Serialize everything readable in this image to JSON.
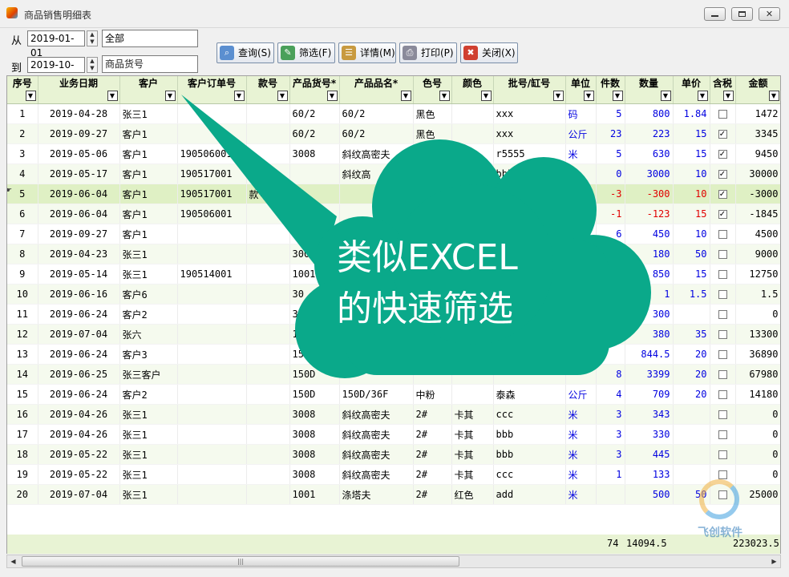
{
  "window": {
    "title": "商品销售明细表"
  },
  "filters": {
    "from_label": "从",
    "to_label": "到",
    "from_date": "2019-01-01",
    "to_date": "2019-10-15",
    "customer_value": "全部",
    "product_placeholder": "商品货号"
  },
  "buttons": {
    "query": "查询(S)",
    "filter": "筛选(F)",
    "detail": "详情(M)",
    "print": "打印(P)",
    "close": "关闭(X)"
  },
  "columns": [
    "序号",
    "业务日期",
    "客户",
    "客户订单号",
    "款号",
    "产品货号*",
    "产品品名*",
    "色号",
    "颜色",
    "批号/缸号",
    "单位",
    "件数",
    "数量",
    "单价",
    "含税",
    "金额"
  ],
  "rows": [
    {
      "no": "1",
      "date": "2019-04-28",
      "cust": "张三1",
      "order": "",
      "style": "",
      "code": "60/2",
      "name": "60/2",
      "cno": "黑色",
      "color": "",
      "batch": "xxx",
      "unit": "码",
      "pcs": "5",
      "qty": "800",
      "price": "1.84",
      "tax": false,
      "amt": "1472"
    },
    {
      "no": "2",
      "date": "2019-09-27",
      "cust": "客户1",
      "order": "",
      "style": "",
      "code": "60/2",
      "name": "60/2",
      "cno": "黑色",
      "color": "",
      "batch": "xxx",
      "unit": "公斤",
      "pcs": "23",
      "qty": "223",
      "price": "15",
      "tax": true,
      "amt": "3345"
    },
    {
      "no": "3",
      "date": "2019-05-06",
      "cust": "客户1",
      "order": "190506001",
      "style": "",
      "code": "3008",
      "name": "斜纹高密夫",
      "cno": "1#",
      "color": "大黑",
      "batch": "r5555",
      "unit": "米",
      "pcs": "5",
      "qty": "630",
      "price": "15",
      "tax": true,
      "amt": "9450"
    },
    {
      "no": "4",
      "date": "2019-05-17",
      "cust": "客户1",
      "order": "190517001",
      "style": "款号",
      "code": "",
      "name": "斜纹高",
      "cno": "",
      "color": "",
      "batch": "bbb",
      "unit": "米",
      "pcs": "0",
      "qty": "3000",
      "price": "10",
      "tax": true,
      "amt": "30000"
    },
    {
      "no": "5",
      "date": "2019-06-04",
      "cust": "客户1",
      "order": "190517001",
      "style": "款号2",
      "code": "",
      "name": "",
      "cno": "",
      "color": "",
      "batch": "bb",
      "unit": "米",
      "pcs": "-3",
      "qty": "-300",
      "price": "10",
      "tax": true,
      "amt": "-3000",
      "neg": true,
      "cur": true
    },
    {
      "no": "6",
      "date": "2019-06-04",
      "cust": "客户1",
      "order": "190506001",
      "style": "",
      "code": "300",
      "name": "",
      "cno": "",
      "color": "",
      "batch": "555",
      "unit": "米",
      "pcs": "-1",
      "qty": "-123",
      "price": "15",
      "tax": true,
      "amt": "-1845",
      "neg": true
    },
    {
      "no": "7",
      "date": "2019-09-27",
      "cust": "客户1",
      "order": "",
      "style": "",
      "code": "3008",
      "name": "",
      "cno": "",
      "color": "",
      "batch": "",
      "unit": "",
      "pcs": "6",
      "qty": "450",
      "price": "10",
      "tax": false,
      "amt": "4500"
    },
    {
      "no": "8",
      "date": "2019-04-23",
      "cust": "张三1",
      "order": "",
      "style": "",
      "code": "3008",
      "name": "",
      "cno": "",
      "color": "",
      "batch": "",
      "unit": "",
      "pcs": "3",
      "qty": "180",
      "price": "50",
      "tax": false,
      "amt": "9000"
    },
    {
      "no": "9",
      "date": "2019-05-14",
      "cust": "张三1",
      "order": "190514001",
      "style": "",
      "code": "1001",
      "name": "",
      "cno": "",
      "color": "",
      "batch": "",
      "unit": "",
      "pcs": "",
      "qty": "850",
      "price": "15",
      "tax": false,
      "amt": "12750"
    },
    {
      "no": "10",
      "date": "2019-06-16",
      "cust": "客户6",
      "order": "",
      "style": "",
      "code": "30",
      "name": "",
      "cno": "",
      "color": "",
      "batch": "",
      "unit": "",
      "pcs": "",
      "qty": "1",
      "price": "1.5",
      "tax": false,
      "amt": "1.5"
    },
    {
      "no": "11",
      "date": "2019-06-24",
      "cust": "客户2",
      "order": "",
      "style": "",
      "code": "3",
      "name": "",
      "cno": "",
      "color": "",
      "batch": "",
      "unit": "",
      "pcs": "",
      "qty": "300",
      "price": "",
      "tax": false,
      "amt": "0"
    },
    {
      "no": "12",
      "date": "2019-07-04",
      "cust": "张六",
      "order": "",
      "style": "",
      "code": "1",
      "name": "",
      "cno": "",
      "color": "",
      "batch": "",
      "unit": "",
      "pcs": "",
      "qty": "380",
      "price": "35",
      "tax": false,
      "amt": "13300"
    },
    {
      "no": "13",
      "date": "2019-06-24",
      "cust": "客户3",
      "order": "",
      "style": "",
      "code": "150",
      "name": "",
      "cno": "",
      "color": "",
      "batch": "",
      "unit": "",
      "pcs": "",
      "qty": "844.5",
      "price": "20",
      "tax": false,
      "amt": "36890"
    },
    {
      "no": "14",
      "date": "2019-06-25",
      "cust": "张三客户",
      "order": "",
      "style": "",
      "code": "150D",
      "name": "",
      "cno": "",
      "color": "",
      "batch": "",
      "unit": "",
      "pcs": "8",
      "qty": "3399",
      "price": "20",
      "tax": false,
      "amt": "67980"
    },
    {
      "no": "15",
      "date": "2019-06-24",
      "cust": "客户2",
      "order": "",
      "style": "",
      "code": "150D",
      "name": "150D/36F",
      "cno": "中粉",
      "color": "",
      "batch": "泰森",
      "unit": "公斤",
      "pcs": "4",
      "qty": "709",
      "price": "20",
      "tax": false,
      "amt": "14180"
    },
    {
      "no": "16",
      "date": "2019-04-26",
      "cust": "张三1",
      "order": "",
      "style": "",
      "code": "3008",
      "name": "斜纹高密夫",
      "cno": "2#",
      "color": "卡其",
      "batch": "ccc",
      "unit": "米",
      "pcs": "3",
      "qty": "343",
      "price": "",
      "tax": false,
      "amt": "0"
    },
    {
      "no": "17",
      "date": "2019-04-26",
      "cust": "张三1",
      "order": "",
      "style": "",
      "code": "3008",
      "name": "斜纹高密夫",
      "cno": "2#",
      "color": "卡其",
      "batch": "bbb",
      "unit": "米",
      "pcs": "3",
      "qty": "330",
      "price": "",
      "tax": false,
      "amt": "0"
    },
    {
      "no": "18",
      "date": "2019-05-22",
      "cust": "张三1",
      "order": "",
      "style": "",
      "code": "3008",
      "name": "斜纹高密夫",
      "cno": "2#",
      "color": "卡其",
      "batch": "bbb",
      "unit": "米",
      "pcs": "3",
      "qty": "445",
      "price": "",
      "tax": false,
      "amt": "0"
    },
    {
      "no": "19",
      "date": "2019-05-22",
      "cust": "张三1",
      "order": "",
      "style": "",
      "code": "3008",
      "name": "斜纹高密夫",
      "cno": "2#",
      "color": "卡其",
      "batch": "ccc",
      "unit": "米",
      "pcs": "1",
      "qty": "133",
      "price": "",
      "tax": false,
      "amt": "0"
    },
    {
      "no": "20",
      "date": "2019-07-04",
      "cust": "张三1",
      "order": "",
      "style": "",
      "code": "1001",
      "name": "涤塔夫",
      "cno": "2#",
      "color": "红色",
      "batch": "add",
      "unit": "米",
      "pcs": "",
      "qty": "500",
      "price": "50",
      "tax": false,
      "amt": "25000"
    }
  ],
  "totals": {
    "pcs": "74",
    "qty": "14094.5",
    "amt": "223023.5"
  },
  "callout": {
    "line1": "类似EXCEL",
    "line2": "的快速筛选",
    "color": "#0aa98a"
  },
  "watermark": {
    "text": "飞创软件"
  },
  "colors": {
    "header_bg": "#e8f3d4",
    "current_row": "#dff0c4",
    "value_blue": "#0000e0",
    "negative_red": "#e00000"
  }
}
